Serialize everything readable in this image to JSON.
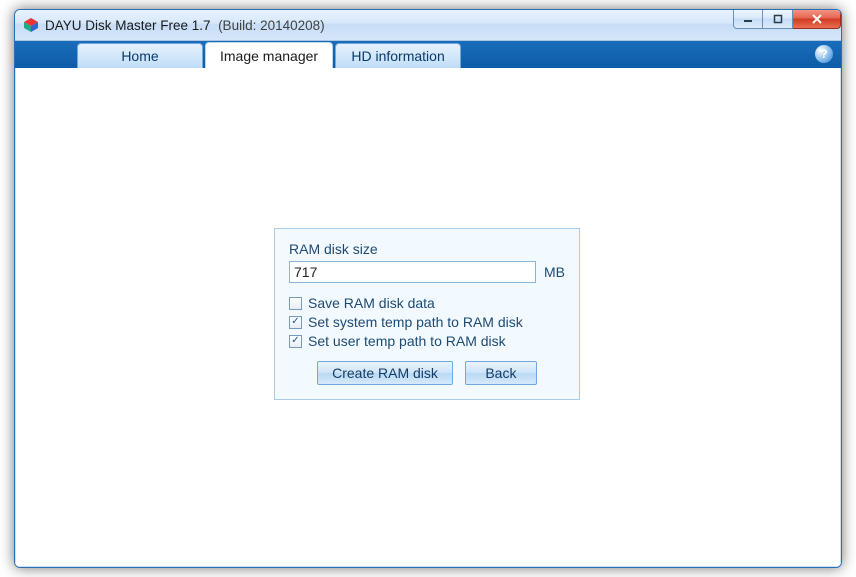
{
  "window": {
    "title": "DAYU Disk Master Free 1.7",
    "build": "(Build: 20140208)"
  },
  "tabs": {
    "home": "Home",
    "image_manager": "Image manager",
    "hd_info": "HD information"
  },
  "help": "?",
  "panel": {
    "size_label": "RAM disk size",
    "size_value": "717",
    "size_unit": "MB",
    "opt_save": "Save RAM disk data",
    "opt_system_temp": "Set system temp path to RAM disk",
    "opt_user_temp": "Set user temp path to RAM disk",
    "opt_save_checked": false,
    "opt_system_temp_checked": true,
    "opt_user_temp_checked": true,
    "create_btn": "Create RAM disk",
    "back_btn": "Back"
  }
}
